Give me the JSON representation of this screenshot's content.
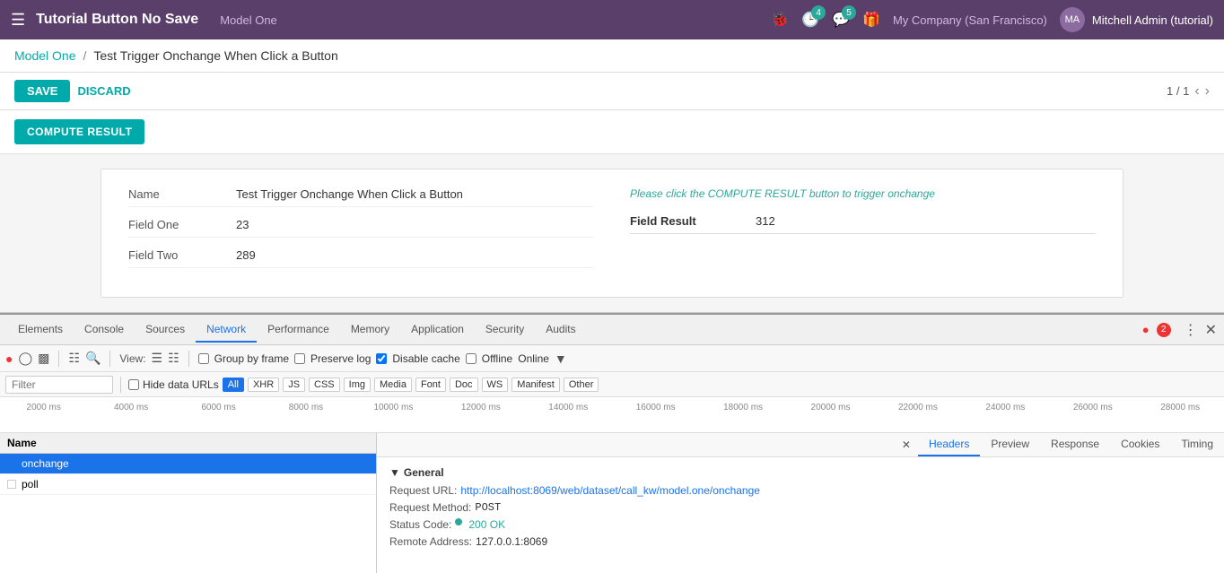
{
  "navbar": {
    "title": "Tutorial Button No Save",
    "model": "Model One",
    "icons": {
      "bug": "🐞",
      "clock_badge": "4",
      "chat_badge": "5",
      "gift": "🎁"
    },
    "company": "My Company (San Francisco)",
    "user": "Mitchell Admin (tutorial)"
  },
  "breadcrumb": {
    "link": "Model One",
    "separator": "/",
    "current": "Test Trigger Onchange When Click a Button"
  },
  "toolbar": {
    "save_label": "SAVE",
    "discard_label": "DISCARD",
    "page_info": "1 / 1"
  },
  "compute_button": {
    "label": "COMPUTE RESULT"
  },
  "form": {
    "fields": [
      {
        "label": "Name",
        "value": "Test Trigger Onchange When Click a Button"
      },
      {
        "label": "Field One",
        "value": "23"
      },
      {
        "label": "Field Two",
        "value": "289"
      }
    ],
    "hint": "Please click the COMPUTE RESULT button to trigger onchange",
    "result_label": "Field Result",
    "result_value": "312"
  },
  "devtools": {
    "tabs": [
      {
        "label": "Elements",
        "active": false
      },
      {
        "label": "Console",
        "active": false
      },
      {
        "label": "Sources",
        "active": false
      },
      {
        "label": "Network",
        "active": true
      },
      {
        "label": "Performance",
        "active": false
      },
      {
        "label": "Memory",
        "active": false
      },
      {
        "label": "Application",
        "active": false
      },
      {
        "label": "Security",
        "active": false
      },
      {
        "label": "Audits",
        "active": false
      }
    ],
    "error_badge": "2",
    "toolbar2": {
      "view_label": "View:",
      "group_by_frame_label": "Group by frame",
      "preserve_log_label": "Preserve log",
      "disable_cache_label": "Disable cache",
      "disable_cache_checked": true,
      "offline_label": "Offline",
      "online_label": "Online"
    },
    "filter": {
      "placeholder": "Filter",
      "hide_data_urls_label": "Hide data URLs",
      "chips": [
        "All",
        "XHR",
        "JS",
        "CSS",
        "Img",
        "Media",
        "Font",
        "Doc",
        "WS",
        "Manifest",
        "Other"
      ]
    },
    "timeline": {
      "labels": [
        "2000 ms",
        "4000 ms",
        "6000 ms",
        "8000 ms",
        "10000 ms",
        "12000 ms",
        "14000 ms",
        "16000 ms",
        "18000 ms",
        "20000 ms",
        "22000 ms",
        "24000 ms",
        "26000 ms",
        "28000 ms"
      ]
    },
    "network_list": {
      "header": "Name",
      "items": [
        {
          "name": "onchange",
          "selected": true
        },
        {
          "name": "poll",
          "selected": false
        }
      ]
    },
    "details": {
      "tabs": [
        "Headers",
        "Preview",
        "Response",
        "Cookies",
        "Timing"
      ],
      "active_tab": "Headers",
      "general_section": {
        "title": "General",
        "request_url_label": "Request URL:",
        "request_url_value": "http://localhost:8069/web/dataset/call_kw/model.one/onchange",
        "request_method_label": "Request Method:",
        "request_method_value": "POST",
        "status_code_label": "Status Code:",
        "status_code_value": "200 OK",
        "remote_address_label": "Remote Address:",
        "remote_address_value": "127.0.0.1:8069"
      }
    }
  }
}
